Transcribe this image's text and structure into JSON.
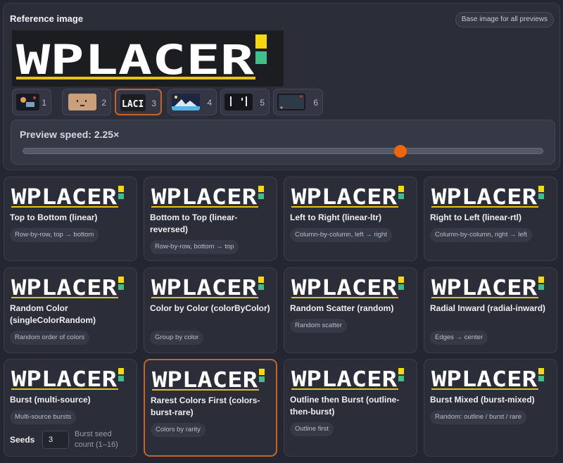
{
  "reference": {
    "title": "Reference image",
    "badge": "Base image for all previews",
    "logo_text": "WPLACER"
  },
  "thumbnails": [
    {
      "num": "1",
      "icon": "space-scene-icon",
      "selected": false
    },
    {
      "num": "2",
      "icon": "face-icon",
      "selected": false
    },
    {
      "num": "3",
      "icon": "wplacer-logo-icon",
      "selected": true,
      "thumb_text": "LACI"
    },
    {
      "num": "4",
      "icon": "landscape-icon",
      "selected": false
    },
    {
      "num": "5",
      "icon": "dark-pattern-icon",
      "selected": false
    },
    {
      "num": "6",
      "icon": "dark-frame-icon",
      "selected": false
    }
  ],
  "speed": {
    "label": "Preview speed: 2.25×",
    "value_fraction": 0.725
  },
  "modes": [
    {
      "title": "Top to Bottom (linear)",
      "desc": "Row-by-row, top → bottom"
    },
    {
      "title": "Bottom to Top (linear-reversed)",
      "desc": "Row-by-row, bottom → top"
    },
    {
      "title": "Left to Right (linear-ltr)",
      "desc": "Column-by-column, left → right"
    },
    {
      "title": "Right to Left (linear-rtl)",
      "desc": "Column-by-column, right → left"
    },
    {
      "title": "Random Color (singleColorRandom)",
      "desc": "Random order of colors"
    },
    {
      "title": "Color by Color (colorByColor)",
      "desc": "Group by color"
    },
    {
      "title": "Random Scatter (random)",
      "desc": "Random scatter"
    },
    {
      "title": "Radial Inward (radial-inward)",
      "desc": "Edges → center"
    },
    {
      "title": "Burst (multi-source)",
      "desc": "Multi-source bursts"
    },
    {
      "title": "Rarest Colors First (colors-burst-rare)",
      "desc": "Colors by rarity"
    },
    {
      "title": "Outline then Burst (outline-then-burst)",
      "desc": "Outline first"
    },
    {
      "title": "Burst Mixed (burst-mixed)",
      "desc": "Random: outline / burst / rare"
    }
  ],
  "seeds": {
    "label": "Seeds",
    "value": "3",
    "help": "Burst seed count (1–16)"
  },
  "colors": {
    "accent": "#f0640a",
    "selected_border": "#c4632a",
    "logo_yellow": "#f5d90a",
    "logo_green": "#3fbf8a"
  }
}
